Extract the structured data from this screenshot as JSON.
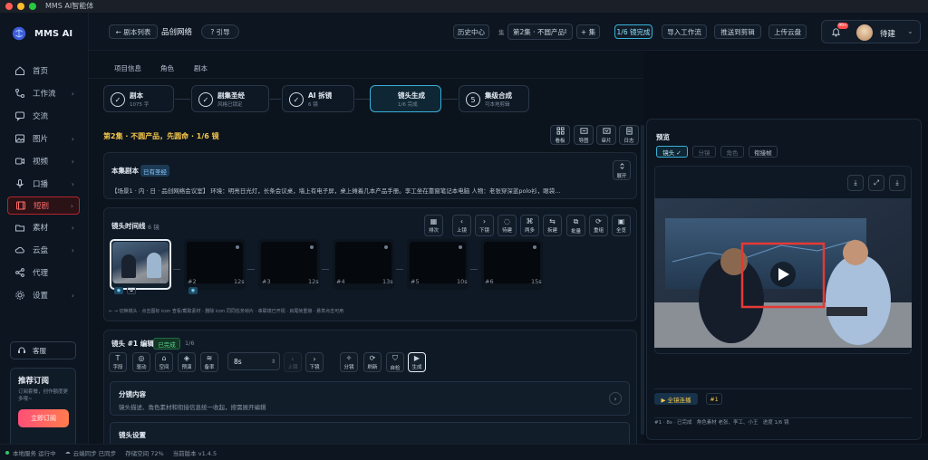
{
  "window": {
    "title": "MMS AI智能体"
  },
  "brand": {
    "name": "MMS AI",
    "accent": "#ff4d4f",
    "primary": "#3ab0d8"
  },
  "sidebar": {
    "items": [
      {
        "label": "首页",
        "icon": "home-icon",
        "chev": ""
      },
      {
        "label": "工作流",
        "icon": "workflow-icon",
        "chev": "›"
      },
      {
        "label": "交流",
        "icon": "chat-icon",
        "chev": ""
      },
      {
        "label": "图片",
        "icon": "image-icon",
        "chev": "›"
      },
      {
        "label": "视频",
        "icon": "video-icon",
        "chev": "›"
      },
      {
        "label": "口播",
        "icon": "mic-icon",
        "chev": "›"
      },
      {
        "label": "短剧",
        "icon": "film-icon",
        "chev": "›"
      },
      {
        "label": "素材",
        "icon": "assets-icon",
        "chev": "›"
      },
      {
        "label": "云盘",
        "icon": "cloud-icon",
        "chev": "›"
      },
      {
        "label": "代理",
        "icon": "share-icon",
        "chev": ""
      },
      {
        "label": "设置",
        "icon": "settings-icon",
        "chev": "›"
      }
    ],
    "service": "客服",
    "promo": {
      "title": "推荐订阅",
      "desc": "订阅套餐，创作额度更多哦~",
      "button": "立即订阅"
    }
  },
  "header": {
    "back": "← 剧本列表",
    "project": "品创网络",
    "guide": "? 引导",
    "history": "历史中心",
    "episode_label": "集",
    "episode_value": "第2集 · 不圆产品",
    "add_episode": "+ 集",
    "progress_done": "1/6 镜完成",
    "import": "导入工作流",
    "push": "推送到剪辑",
    "upload": "上传云盘",
    "badge": "99+",
    "user": "待建"
  },
  "tabs": [
    "项目信息",
    "角色",
    "剧本"
  ],
  "steps": [
    {
      "num": "✓",
      "title": "剧本",
      "sub": "1075 字"
    },
    {
      "num": "✓",
      "title": "剧集圣经",
      "sub": "风格已锁定"
    },
    {
      "num": "✓",
      "title": "AI 拆镜",
      "sub": "6 镜"
    },
    {
      "num": "",
      "title": "镜头生成",
      "sub": "1/6 完成"
    },
    {
      "num": "5",
      "title": "集级合成",
      "sub": "可本地剪辑"
    }
  ],
  "episode_title": "第2集 · 不圆产品，先圆命 · 1/6 镜",
  "top_tools": [
    "看板",
    "导图",
    "审片",
    "日志"
  ],
  "script": {
    "title": "本集剧本",
    "tag": "已有圣经",
    "expand": "展开",
    "text": "【场景1 · 内 · 日 · 品创网络会议室】 环境：明亮日光灯，长条会议桌，墙上有电子屏，桌上摊着几本产品手册。李工坐在靠窗笔记本电脑 人物：老张穿深蓝polo衫，眼袋..."
  },
  "timeline": {
    "title": "镜头时间线",
    "count": "6 镜",
    "tools": [
      "排次",
      "上镜",
      "下镜",
      "待建",
      "两多",
      "拆建",
      "批量",
      "重组",
      "全览"
    ],
    "shots": [
      {
        "id": "#1",
        "dur": "6s"
      },
      {
        "id": "#2",
        "dur": "12s"
      },
      {
        "id": "#3",
        "dur": "12s"
      },
      {
        "id": "#4",
        "dur": "13s"
      },
      {
        "id": "#5",
        "dur": "10s"
      },
      {
        "id": "#6",
        "dur": "15s"
      }
    ],
    "hint": "← → 切换镜头 · 点击图标 icon 查看/截取素材 · 删除 icon 同同任务帧片 · 串联镜已开视 · 启尾帧重接 · 悬草点击可用"
  },
  "editor": {
    "title": "镜头 #1 编辑",
    "tag": "已完成",
    "count": "1/6",
    "tools": [
      "字段",
      "驱动",
      "空间",
      "预演",
      "备率"
    ],
    "duration": "8s",
    "nav": [
      "上镜",
      "下镜"
    ],
    "actions": [
      "分镜",
      "刷新",
      "自检",
      "生成"
    ],
    "section1_title": "分镜内容",
    "section1_desc": "镜头描述、角色素材和衔接信息统一收起，按需展开编辑",
    "section2_title": "镜头设置"
  },
  "preview": {
    "title": "预览",
    "tabs": [
      "镜头 ✓",
      "分镜",
      "角色",
      "衔接帧"
    ],
    "play_all": "▶ 全镜连播",
    "shot_tag": "#1",
    "meta": "#1 · 8s · 已完成   角色素材 老张、李工、小王   进度 1/6 镜"
  },
  "status": {
    "service": "本地服务 运行中",
    "sync": "云端同步 已同步",
    "storage": "存储空间 72%",
    "version": "当前版本 v1.4.5"
  }
}
